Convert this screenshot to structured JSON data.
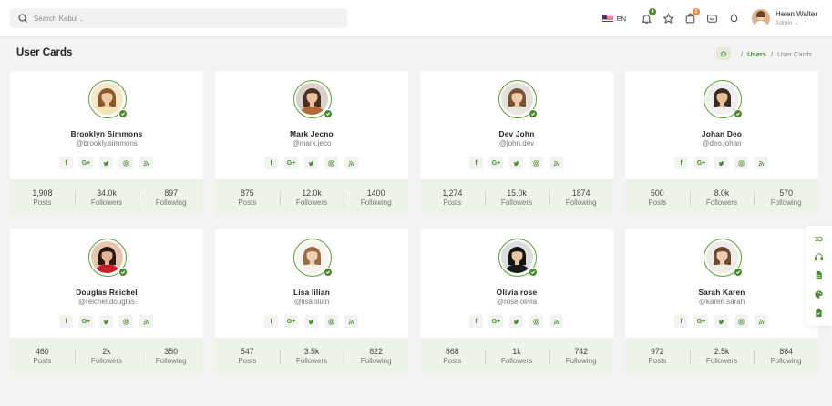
{
  "header": {
    "search_placeholder": "Search Kabul ..",
    "language": "EN",
    "notifications_count": "4",
    "cart_count": "1",
    "user_name": "Helen Walter",
    "user_role": "Admin ⌄"
  },
  "page": {
    "title": "User Cards",
    "breadcrumb": {
      "sep1": "/",
      "link": "Users",
      "sep2": "/",
      "current": "User Cards"
    }
  },
  "socials": [
    "f",
    "G+",
    "twitter",
    "instagram",
    "rss"
  ],
  "colors": {
    "accent": "#4a8a2c",
    "stats_bg": "#eef2e8",
    "verified": "#4a8a2c"
  },
  "users": [
    {
      "name": "Brooklyn Simmons",
      "handle": "@brookly.simmons",
      "posts": "1,908",
      "followers": "34.0k",
      "following": "897",
      "skin": "#f0c9a5",
      "hair": "#8a5a2b",
      "shirt": "#f4e3b5",
      "bg": "#f6e7c8"
    },
    {
      "name": "Mark Jecno",
      "handle": "@mark.jeco",
      "posts": "875",
      "followers": "12.0k",
      "following": "1400",
      "skin": "#eac19c",
      "hair": "#4a3024",
      "shirt": "#b2693a",
      "bg": "#d9d2c9"
    },
    {
      "name": "Dev John",
      "handle": "@john.dev",
      "posts": "1,274",
      "followers": "15.0k",
      "following": "1874",
      "skin": "#efcba9",
      "hair": "#7a5236",
      "shirt": "#e8e4de",
      "bg": "#e4e0dc"
    },
    {
      "name": "Johan Deo",
      "handle": "@deo.johan",
      "posts": "500",
      "followers": "8.0k",
      "following": "570",
      "skin": "#e7bf9a",
      "hair": "#3a2a20",
      "shirt": "#f1f1f1",
      "bg": "#eeeeee"
    },
    {
      "name": "Douglas Reichel",
      "handle": "@reichel.douglas",
      "posts": "460",
      "followers": "2k",
      "following": "350",
      "skin": "#e6b594",
      "hair": "#2a1a14",
      "shirt": "#c81f2b",
      "bg": "#e8c5ad"
    },
    {
      "name": "Lisa lilian",
      "handle": "@lisa.lilian",
      "posts": "547",
      "followers": "3.5k",
      "following": "822",
      "skin": "#f1cfb2",
      "hair": "#9a6c45",
      "shirt": "#f4f1ec",
      "bg": "#f7f4f0"
    },
    {
      "name": "Olivia rose",
      "handle": "@rose.olivia",
      "posts": "868",
      "followers": "1k",
      "following": "742",
      "skin": "#e9c4a5",
      "hair": "#151515",
      "shirt": "#1a1a1a",
      "bg": "#dcdcdc"
    },
    {
      "name": "Sarah Karen",
      "handle": "@karen.sarah",
      "posts": "972",
      "followers": "2.5k",
      "following": "864",
      "skin": "#f0cdb0",
      "hair": "#6a4a32",
      "shirt": "#eeeae4",
      "bg": "#ecebe8"
    }
  ],
  "labels": {
    "posts": "Posts",
    "followers": "Followers",
    "following": "Following"
  },
  "side_toolbar": [
    "toggle-icon",
    "headset-icon",
    "document-icon",
    "palette-icon",
    "clipboard-icon"
  ]
}
